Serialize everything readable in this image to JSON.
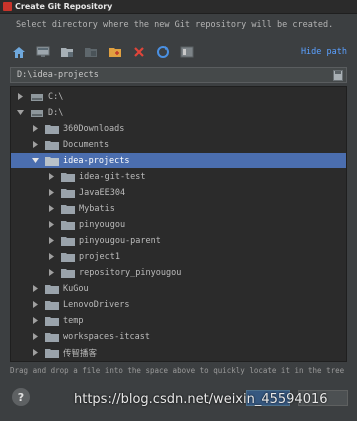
{
  "window": {
    "title": "Create Git Repository"
  },
  "description": "Select directory where the new Git repository will be created.",
  "toolbar": {
    "buttons": [
      {
        "icon": "home-icon"
      },
      {
        "icon": "desktop-icon"
      },
      {
        "icon": "project-folder-icon"
      },
      {
        "icon": "module-folder-icon"
      },
      {
        "icon": "new-folder-icon"
      },
      {
        "icon": "delete-icon"
      },
      {
        "icon": "refresh-icon"
      },
      {
        "icon": "show-hidden-icon"
      }
    ],
    "hide_path_label": "Hide path"
  },
  "path": {
    "value": "D:\\idea-projects"
  },
  "tree": {
    "items": [
      {
        "label": "C:\\"
      },
      {
        "label": "D:\\"
      },
      {
        "label": "360Downloads"
      },
      {
        "label": "Documents"
      },
      {
        "label": "idea-projects"
      },
      {
        "label": "idea-git-test"
      },
      {
        "label": "JavaEE304"
      },
      {
        "label": "Mybatis"
      },
      {
        "label": "pinyougou"
      },
      {
        "label": "pinyougou-parent"
      },
      {
        "label": "project1"
      },
      {
        "label": "repository_pinyougou"
      },
      {
        "label": "KuGou"
      },
      {
        "label": "LenovoDrivers"
      },
      {
        "label": "temp"
      },
      {
        "label": "workspaces-itcast"
      },
      {
        "label": "传智播客"
      }
    ]
  },
  "hint": "Drag and drop a file into the space above to quickly locate it in the tree",
  "help_label": "?",
  "watermark": "https://blog.csdn.net/weixin_45594016",
  "colors": {
    "selection": "#4b6eaf",
    "link": "#5aa0ff",
    "folder": "#9aa3ab"
  }
}
